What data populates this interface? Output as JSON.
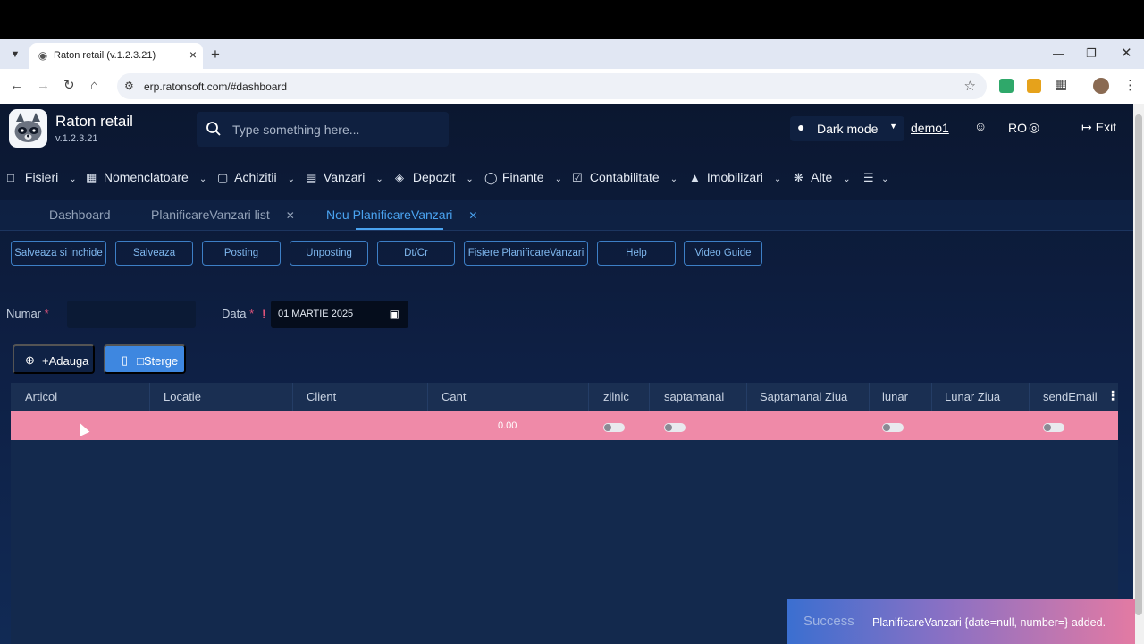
{
  "browser": {
    "tab_title": "Raton retail (v.1.2.3.21)",
    "url": "erp.ratonsoft.com/#dashboard"
  },
  "app": {
    "brand_name": "Raton retail",
    "version": "v.1.2.3.21",
    "search_placeholder": "Type something here...",
    "dark_mode_label": "Dark mode",
    "user": "demo1",
    "language": "RO",
    "exit_label": "Exit"
  },
  "menu": [
    {
      "label": "Fisieri",
      "icon": "folder-icon"
    },
    {
      "label": "Nomenclatoare",
      "icon": "grid-icon"
    },
    {
      "label": "Achizitii",
      "icon": "bag-icon"
    },
    {
      "label": "Vanzari",
      "icon": "cart-icon"
    },
    {
      "label": "Depozit",
      "icon": "layers-icon"
    },
    {
      "label": "Finante",
      "icon": "dollar-icon"
    },
    {
      "label": "Contabilitate",
      "icon": "checkbox-icon"
    },
    {
      "label": "Imobilizari",
      "icon": "chart-icon"
    },
    {
      "label": "Alte",
      "icon": "nodes-icon"
    }
  ],
  "tabs": [
    {
      "label": "Dashboard",
      "active": false
    },
    {
      "label": "PlanificareVanzari list",
      "active": false
    },
    {
      "label": "Nou PlanificareVanzari",
      "active": true
    }
  ],
  "actions": [
    "Salveaza si inchide",
    "Salveaza",
    "Posting",
    "Unposting",
    "Dt/Cr",
    "Fisiere PlanificareVanzari",
    "Help",
    "Video Guide"
  ],
  "form": {
    "numar_label": "Numar",
    "numar_value": "",
    "data_label": "Data",
    "data_value": "01 MARTIE 2025",
    "required_mark": "*",
    "warning_mark": "!"
  },
  "grid_buttons": {
    "add_label": "+Adauga",
    "delete_label": "□Sterge"
  },
  "grid": {
    "columns": [
      "Articol",
      "Locatie",
      "Client",
      "Cant",
      "zilnic",
      "saptamanal",
      "Saptamanal Ziua",
      "lunar",
      "Lunar Ziua",
      "sendEmail"
    ],
    "rows": [
      {
        "articol": "",
        "locatie": "",
        "client": "",
        "cant": "0.00",
        "zilnic": false,
        "saptamanal": false,
        "saptamanal_ziua": "",
        "lunar": false,
        "lunar_ziua": "",
        "sendEmail": false
      }
    ]
  },
  "toast": {
    "title": "Success",
    "message": "PlanificareVanzari {date=null, number=} added."
  }
}
